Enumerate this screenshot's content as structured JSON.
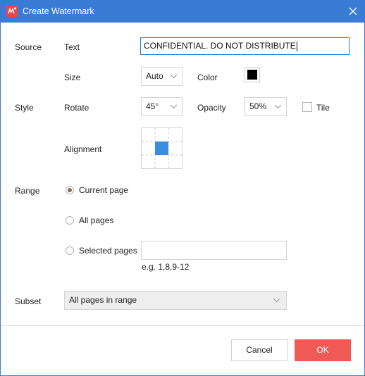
{
  "window": {
    "title": "Create Watermark"
  },
  "source": {
    "section_label": "Source",
    "text_label": "Text",
    "text_value": "CONFIDENTIAL. DO NOT DISTRIBUTE"
  },
  "style": {
    "section_label": "Style",
    "size_label": "Size",
    "size_value": "Auto",
    "color_label": "Color",
    "color_value": "#000000",
    "rotate_label": "Rotate",
    "rotate_value": "45°",
    "opacity_label": "Opacity",
    "opacity_value": "50%",
    "tile_label": "Tile",
    "tile_checked": false,
    "alignment_label": "Alignment",
    "alignment_selected": "center"
  },
  "range": {
    "section_label": "Range",
    "options": [
      {
        "label": "Current page",
        "checked": true
      },
      {
        "label": "All pages",
        "checked": false
      },
      {
        "label": "Selected pages",
        "checked": false
      }
    ],
    "pages_value": "",
    "pages_hint": "e.g. 1,8,9-12"
  },
  "subset": {
    "section_label": "Subset",
    "value": "All pages in range"
  },
  "buttons": {
    "cancel": "Cancel",
    "ok": "OK"
  },
  "colors": {
    "accent": "#3a7bd5",
    "ok_button": "#ef5a57",
    "selected_cell": "#3b8de0"
  },
  "icons": {
    "app": "app-logo-icon",
    "close": "close-icon",
    "dropdown": "chevron-down-icon"
  }
}
